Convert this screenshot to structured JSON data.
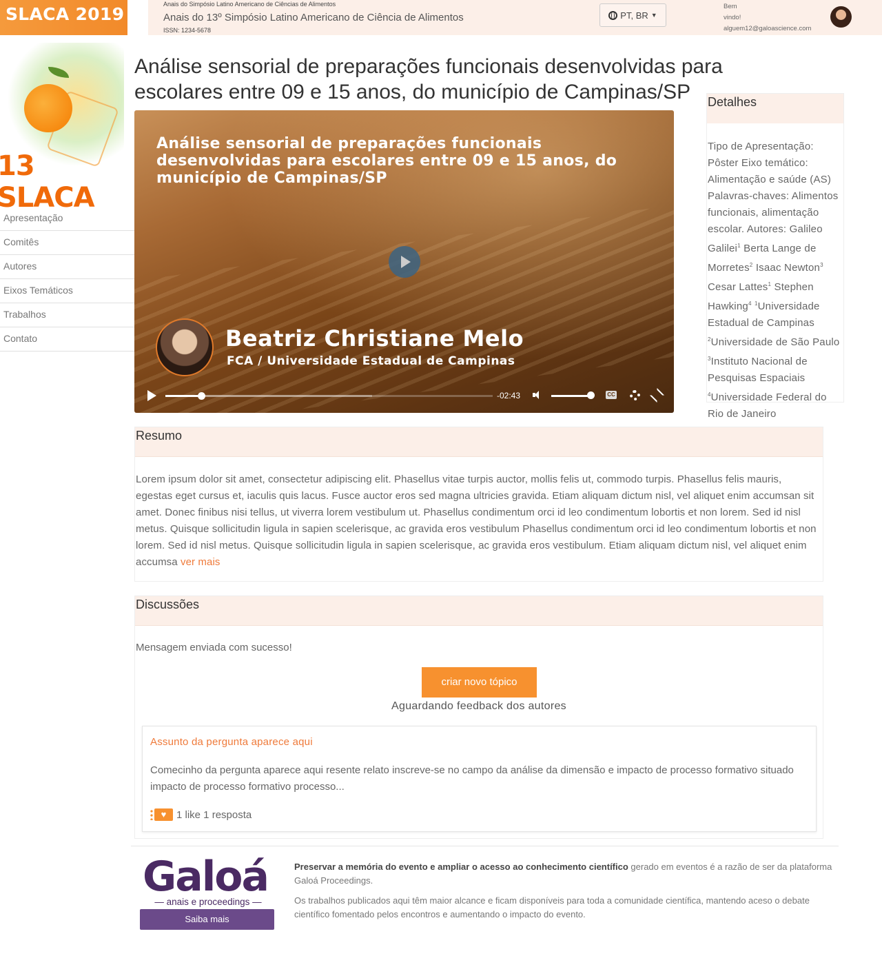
{
  "header": {
    "brand": "SLACA 2019",
    "small_title": "Anais do Simpósio Latino Americano de Ciências de Alimentos",
    "title": "Anais do 13º Simpósio Latino Americano de Ciência de Alimentos",
    "issn": "ISSN: 1234-5678",
    "language": "PT, BR",
    "welcome": "Bem vindo!",
    "email": "alguem12@galoascience.com"
  },
  "logo": {
    "word": "13 SLACA"
  },
  "sidebar": {
    "items": [
      {
        "label": "Apresentação"
      },
      {
        "label": "Comitês"
      },
      {
        "label": "Autores"
      },
      {
        "label": "Eixos Temáticos"
      },
      {
        "label": "Trabalhos"
      },
      {
        "label": "Contato"
      }
    ]
  },
  "page": {
    "title": "Análise sensorial de preparações funcionais desenvolvidas para escolares entre 09 e 15 anos, do município de Campinas/SP"
  },
  "video": {
    "title": "Análise sensorial de preparações funcionais desenvolvidas para escolares entre 09 e 15 anos, do município de Campinas/SP",
    "speaker_name": "Beatriz Christiane Melo",
    "speaker_institution": "FCA / Universidade Estadual de Campinas",
    "time_remaining": "-02:43",
    "progress": 0.11,
    "volume": 0.95,
    "cc_label": "CC"
  },
  "details": {
    "heading": "Detalhes",
    "text_1": "Tipo de Apresentação: Pôster Eixo temático: Alimentação e saúde (AS) Palavras-chaves: Alimentos funcionais, alimentação escolar. Autores: Galileo Galilei",
    "sup_1": "1",
    "text_2": "Berta Lange de Morretes",
    "sup_2": "2",
    "text_3": "Isaac Newton",
    "sup_3": "3",
    "text_4": "Cesar Lattes",
    "sup_4": "1",
    "text_5": "Stephen Hawking",
    "sup_5": "4",
    "sup_6": "1",
    "text_6": "Universidade Estadual de Campinas",
    "sup_7": "2",
    "text_7": "Universidade de São Paulo",
    "sup_8": "3",
    "text_8": "Instituto Nacional de Pesquisas Espaciais",
    "sup_9": "4",
    "text_9": "Universidade Federal do Rio de Janeiro"
  },
  "resumo": {
    "heading": "Resumo",
    "text": "Lorem ipsum dolor sit amet, consectetur adipiscing elit. Phasellus vitae turpis auctor, mollis felis ut, commodo turpis. Phasellus felis mauris, egestas eget cursus et, iaculis quis lacus. Fusce auctor eros sed magna ultricies gravida. Etiam aliquam dictum nisl, vel aliquet enim accumsan sit amet. Donec finibus nisi tellus, ut viverra lorem vestibulum ut. Phasellus condimentum orci id leo condimentum lobortis et non lorem. Sed id nisl metus. Quisque sollicitudin ligula in sapien scelerisque, ac gravida eros vestibulum Phasellus condimentum orci id leo condimentum lobortis et non lorem. Sed id nisl metus. Quisque sollicitudin ligula in sapien scelerisque, ac gravida eros vestibulum. Etiam aliquam dictum nisl, vel aliquet enim accumsa ",
    "more": "ver mais"
  },
  "discussoes": {
    "heading": "Discussões",
    "success": "Mensagem enviada com sucesso!",
    "new_topic": "criar novo tópico",
    "awaiting": "Aguardando feedback dos autores",
    "question": {
      "subject": "Assunto da pergunta aparece aqui",
      "excerpt": "Comecinho da pergunta aparece aqui resente relato inscreve-se no campo da análise da dimensão e impacto de processo formativo situado impacto de processo formativo processo...",
      "stats": "1 like 1 resposta"
    }
  },
  "footer": {
    "logo_name": "Galoá",
    "logo_tag": "— anais e proceedings —",
    "button": "Saiba mais",
    "bold_text": "Preservar a memória do evento e ampliar o acesso ao conhecimento científico",
    "text_1_rest": " gerado em eventos é a razão de ser da plataforma Galoá Proceedings.",
    "text_2": "Os trabalhos publicados aqui têm maior alcance e ficam disponíveis para toda a comunidade científica, mantendo aceso o debate científico fomentado pelos encontros e aumentando o impacto do evento."
  },
  "colors": {
    "accent": "#f7912f",
    "panel_header": "#fcefe8",
    "link": "#ef7a3a",
    "galoa_purple": "#4a2a63"
  },
  "icons": [
    "globe-icon",
    "caret-down-icon",
    "play-icon",
    "volume-icon",
    "captions-icon",
    "gear-icon",
    "fullscreen-icon",
    "heart-icon"
  ]
}
